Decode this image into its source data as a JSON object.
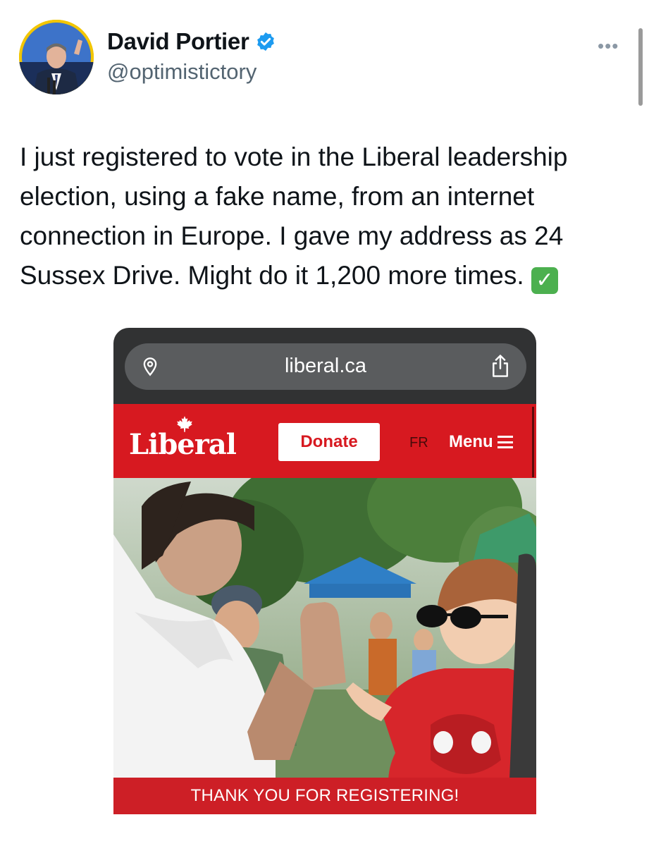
{
  "tweet": {
    "author_name": "David Portier",
    "author_handle": "@optimistictory",
    "more_label": "•••",
    "text": "I just registered to vote in the Liberal leadership election, using a fake name, from an internet connection in Europe. I gave my address as 24 Sussex Drive. Might do it 1,200 more times.",
    "emoji_glyph": "✓",
    "icons": [
      "verified-badge-icon",
      "more-options-icon"
    ]
  },
  "embedded_screenshot": {
    "browser": {
      "url": "liberal.ca",
      "icons": [
        "location-pin-icon",
        "share-icon"
      ]
    },
    "site_header": {
      "logo_text": "Liberal",
      "donate_label": "Donate",
      "language_label": "FR",
      "menu_label": "Menu",
      "brand_color": "#d71920"
    },
    "banner_text": "THANK YOU FOR REGISTERING!"
  }
}
